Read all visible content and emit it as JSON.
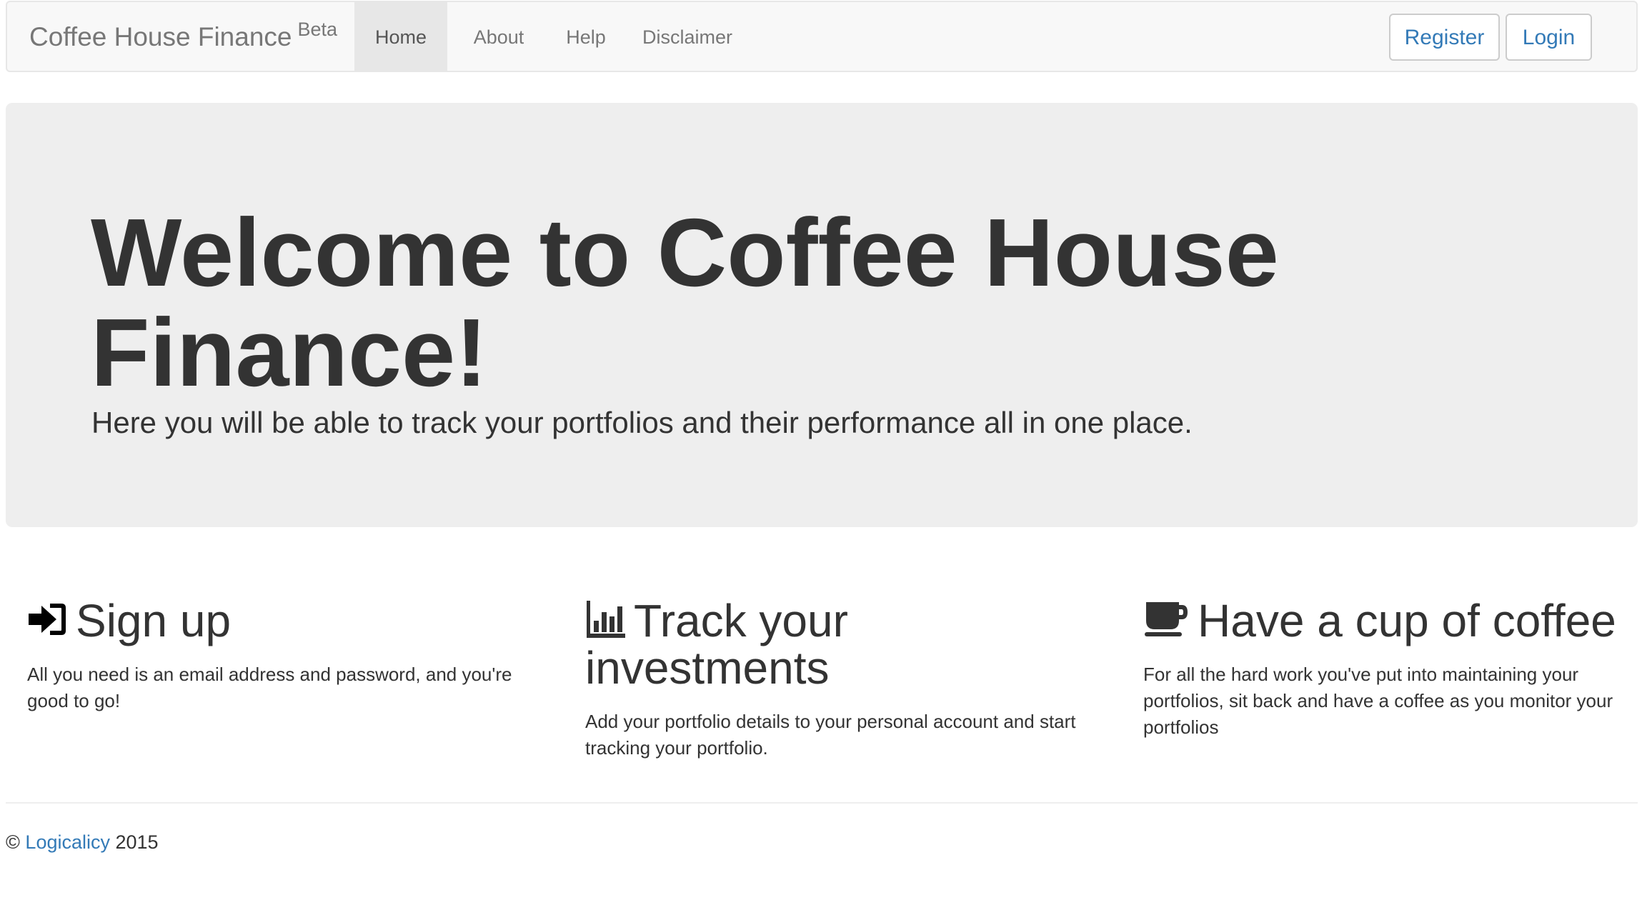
{
  "navbar": {
    "brand": "Coffee House Finance",
    "brand_badge": "Beta",
    "links": [
      {
        "label": "Home",
        "active": true
      },
      {
        "label": "About"
      },
      {
        "label": "Help"
      },
      {
        "label": "Disclaimer"
      }
    ],
    "register_label": "Register",
    "login_label": "Login"
  },
  "jumbotron": {
    "title": "Welcome to Coffee House Finance!",
    "subtitle": "Here you will be able to track your portfolios and their performance all in one place."
  },
  "features": [
    {
      "icon": "sign-in-icon",
      "title": "Sign up",
      "text": "All you need is an email address and password, and you're good to go!"
    },
    {
      "icon": "bar-chart-icon",
      "title": "Track your investments",
      "text": "Add your portfolio details to your personal account and start tracking your portfolio."
    },
    {
      "icon": "coffee-cup-icon",
      "title": "Have a cup of coffee",
      "text": "For all the hard work you've put into maintaining your portfolios, sit back and have a coffee as you monitor your portfolios"
    }
  ],
  "footer": {
    "copyright_symbol": "©",
    "link_label": "Logicalicy",
    "year": "2015"
  },
  "colors": {
    "link": "#337ab7",
    "navbar_bg": "#f8f8f8",
    "jumbotron_bg": "#eeeeee",
    "text": "#333333"
  }
}
